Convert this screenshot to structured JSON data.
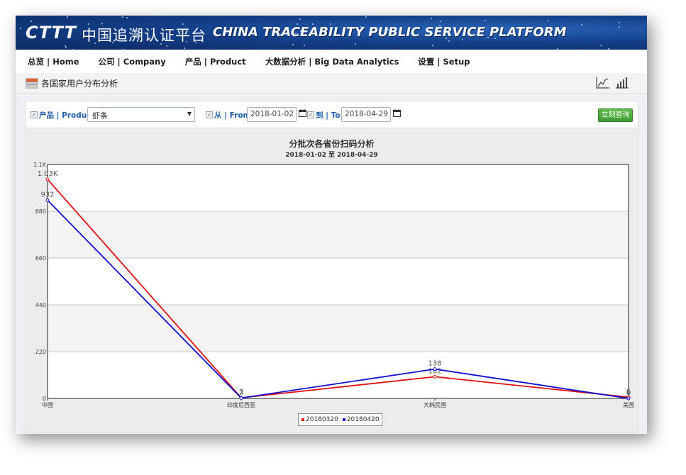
{
  "header": {
    "logo_text": "CTTT",
    "title_cn": "中国追溯认证平台",
    "title_en": "CHINA TRACEABILITY PUBLIC SERVICE PLATFORM"
  },
  "nav": {
    "items": [
      {
        "label": "总览 | Home"
      },
      {
        "label": "公司 | Company"
      },
      {
        "label": "产品 | Product"
      },
      {
        "label": "大数据分析 | Big Data Analytics"
      },
      {
        "label": "设置 | Setup"
      }
    ]
  },
  "breadcrumb": {
    "title": "各国家用户分布分析",
    "icon": "report-icon",
    "view_buttons": [
      "line-chart-icon",
      "bar-chart-icon"
    ]
  },
  "filters": {
    "product_label": "产品 | Product:",
    "product_value": "虾条",
    "from_label": "从 | From:",
    "from_value": "2018-01-02",
    "to_label": "到 | To:",
    "to_value": "2018-04-29",
    "query_button": "立刻查询"
  },
  "chart_data": {
    "type": "line",
    "title": "分批次各省份扫码分析",
    "subtitle": "2018-01-02 至 2018-04-29",
    "categories": [
      "中国",
      "印度尼西亚",
      "大韩民国",
      "美国"
    ],
    "y_ticks": [
      "0",
      "220",
      "440",
      "660",
      "880",
      "1.1K"
    ],
    "ylim": [
      0,
      1100
    ],
    "grid": true,
    "legend_position": "bottom",
    "series": [
      {
        "name": "20180320",
        "color": "#e01010",
        "values": [
          1030,
          3,
          102,
          6
        ],
        "labels": [
          "1.03K",
          "3",
          "102",
          "6"
        ]
      },
      {
        "name": "20180420",
        "color": "#1010d0",
        "values": [
          932,
          2,
          138,
          0
        ],
        "labels": [
          "932",
          "2",
          "138",
          "0"
        ]
      }
    ]
  }
}
